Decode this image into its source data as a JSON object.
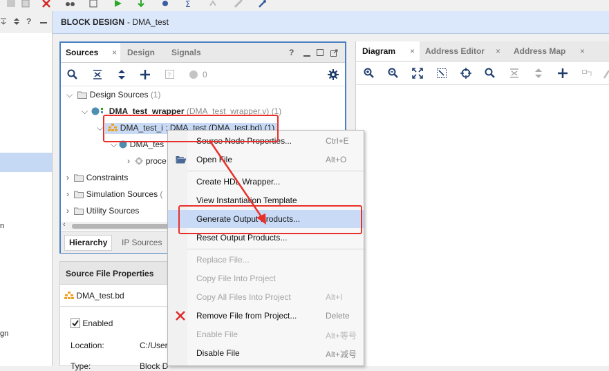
{
  "colors": {
    "accent_red": "#e8302a",
    "selection": "#c8daf5",
    "panel_border": "#4a7fc0",
    "header_bg": "#dbe7fb"
  },
  "left_strip": {
    "icons": [
      "collapse-all-icon",
      "sort-icon",
      "help-icon",
      "minimize-icon"
    ],
    "labels": [
      "n",
      "gn"
    ]
  },
  "block_design": {
    "title": "BLOCK DESIGN",
    "subtitle": "- DMA_test"
  },
  "sources": {
    "tabs": [
      {
        "label": "Sources"
      },
      {
        "label": "Design"
      },
      {
        "label": "Signals"
      }
    ],
    "controls": {
      "help": "?"
    },
    "toolbar": {
      "count": "0"
    },
    "tree": {
      "design_sources": {
        "label": "Design Sources",
        "count": "(1)"
      },
      "wrapper": {
        "label": "DMA_test_wrapper",
        "file": "(DMA_test_wrapper.v)",
        "count": "(1)"
      },
      "bd": {
        "label": "DMA_test_i : DMA_test (DMA_test.bd)",
        "count": "(1)"
      },
      "bd_child": {
        "label": "DMA_tes"
      },
      "proc": {
        "label": "proce"
      },
      "constraints": {
        "label": "Constraints"
      },
      "sim": {
        "label": "Simulation Sources",
        "count": "("
      },
      "utility": {
        "label": "Utility Sources"
      }
    },
    "bottom_tabs": [
      {
        "label": "Hierarchy"
      },
      {
        "label": "IP Sources"
      }
    ]
  },
  "source_file_properties": {
    "title": "Source File Properties",
    "file": "DMA_test.bd",
    "enabled_label": "Enabled",
    "enabled_checked": true,
    "location_label": "Location:",
    "location_value": "C:/User",
    "type_label": "Type:",
    "type_value": "Block D"
  },
  "diagram": {
    "tabs": [
      {
        "label": "Diagram"
      },
      {
        "label": "Address Editor"
      },
      {
        "label": "Address Map"
      }
    ]
  },
  "context_menu": {
    "items": [
      {
        "label": "Source Node Properties...",
        "shortcut": "Ctrl+E",
        "disabled": false
      },
      {
        "label": "Open File",
        "shortcut": "Alt+O",
        "disabled": false
      },
      {
        "label": "Create HDL Wrapper...",
        "shortcut": "",
        "disabled": false
      },
      {
        "label": "View Instantiation Template",
        "shortcut": "",
        "disabled": false
      },
      {
        "label": "Generate Output Products...",
        "shortcut": "",
        "disabled": false
      },
      {
        "label": "Reset Output Products...",
        "shortcut": "",
        "disabled": false
      },
      {
        "label": "Replace File...",
        "shortcut": "",
        "disabled": true
      },
      {
        "label": "Copy File Into Project",
        "shortcut": "",
        "disabled": true
      },
      {
        "label": "Copy All Files Into Project",
        "shortcut": "Alt+I",
        "disabled": true
      },
      {
        "label": "Remove File from Project...",
        "shortcut": "Delete",
        "disabled": false
      },
      {
        "label": "Enable File",
        "shortcut": "Alt+等号",
        "disabled": true
      },
      {
        "label": "Disable File",
        "shortcut": "Alt+减号",
        "disabled": false
      }
    ]
  }
}
